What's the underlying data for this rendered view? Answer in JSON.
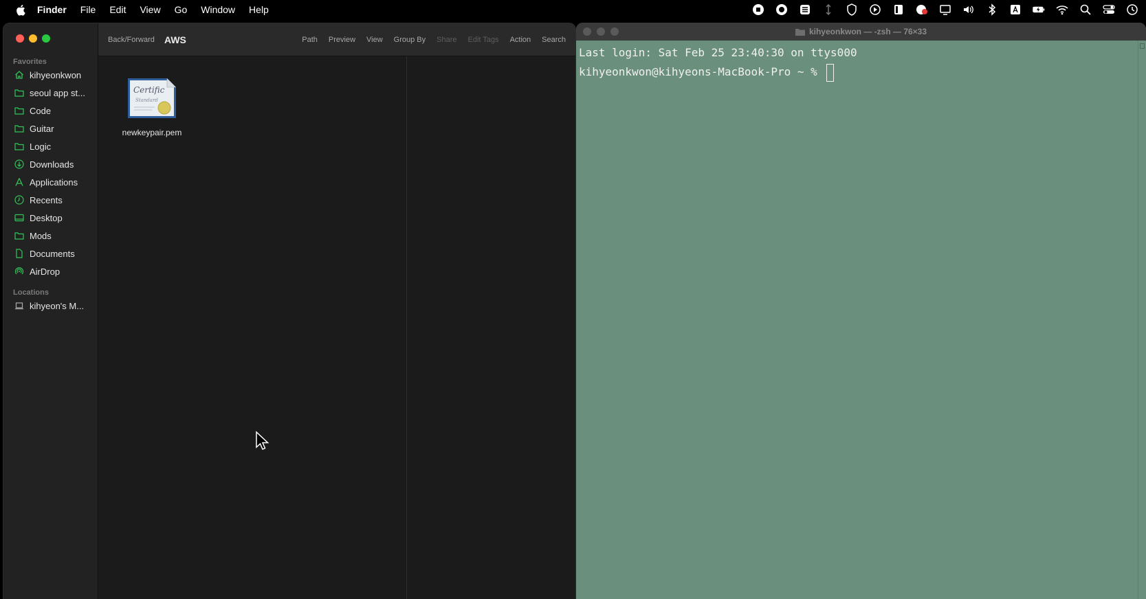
{
  "menubar": {
    "app_name": "Finder",
    "items": [
      "File",
      "Edit",
      "View",
      "Go",
      "Window",
      "Help"
    ]
  },
  "finder": {
    "sidebar": {
      "favorites_header": "Favorites",
      "favorites": [
        {
          "label": "kihyeonkwon",
          "icon": "home-icon"
        },
        {
          "label": "seoul app st...",
          "icon": "folder-icon"
        },
        {
          "label": "Code",
          "icon": "folder-icon"
        },
        {
          "label": "Guitar",
          "icon": "folder-icon"
        },
        {
          "label": "Logic",
          "icon": "folder-icon"
        },
        {
          "label": "Downloads",
          "icon": "download-icon"
        },
        {
          "label": "Applications",
          "icon": "applications-icon"
        },
        {
          "label": "Recents",
          "icon": "clock-icon"
        },
        {
          "label": "Desktop",
          "icon": "desktop-icon"
        },
        {
          "label": "Mods",
          "icon": "folder-icon"
        },
        {
          "label": "Documents",
          "icon": "document-icon"
        },
        {
          "label": "AirDrop",
          "icon": "airdrop-icon"
        }
      ],
      "locations_header": "Locations",
      "locations": [
        {
          "label": "kihyeon's M...",
          "icon": "laptop-icon"
        }
      ]
    },
    "toolbar": {
      "back_forward": "Back/Forward",
      "title": "AWS",
      "path": "Path",
      "preview": "Preview",
      "view": "View",
      "group_by": "Group By",
      "share": "Share",
      "edit_tags": "Edit Tags",
      "action": "Action",
      "search": "Search"
    },
    "files": [
      {
        "name": "newkeypair.pem",
        "icon": "certificate-icon"
      }
    ]
  },
  "terminal": {
    "title": "kihyeonkwon — -zsh — 76×33",
    "lines": [
      "Last login: Sat Feb 25 23:40:30 on ttys000",
      "kihyeonkwon@kihyeons-MacBook-Pro ~ % "
    ]
  },
  "colors": {
    "terminal_bg": "#6a8f7c",
    "sidebar_accent": "#31c558"
  }
}
